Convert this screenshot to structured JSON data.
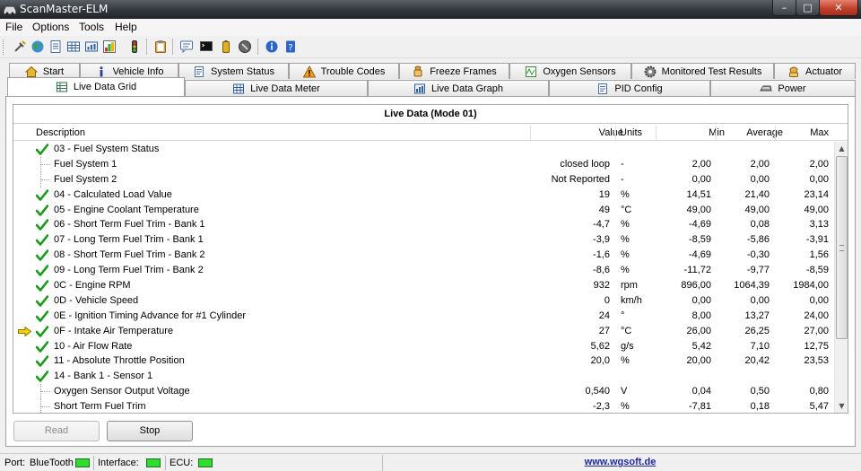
{
  "window": {
    "title": "ScanMaster-ELM",
    "controls": {
      "minimize": "–",
      "maximize": "□",
      "close": "✕"
    }
  },
  "menu": [
    "File",
    "Options",
    "Tools",
    "Help"
  ],
  "toolbar": {
    "icons": [
      "connect-icon",
      "globe-icon",
      "document-icon",
      "grid-icon",
      "table-icon",
      "chart-icon",
      "traffic-light-icon",
      "clipboard-icon",
      "terminal-chat-icon",
      "monitor-icon",
      "battery-icon",
      "stop-icon",
      "info-icon",
      "help-icon"
    ]
  },
  "tabs": {
    "row1": [
      {
        "label": "Start",
        "icon": "home-icon"
      },
      {
        "label": "Vehicle Info",
        "icon": "info-icon"
      },
      {
        "label": "System Status",
        "icon": "document-icon"
      },
      {
        "label": "Trouble Codes",
        "icon": "warning-icon"
      },
      {
        "label": "Freeze Frames",
        "icon": "snowflake-icon"
      },
      {
        "label": "Oxygen Sensors",
        "icon": "sensor-icon"
      },
      {
        "label": "Monitored Test Results",
        "icon": "gear-icon"
      },
      {
        "label": "Actuator",
        "icon": "actuator-icon"
      }
    ],
    "row2": [
      {
        "label": "Live Data Grid",
        "icon": "grid-icon",
        "active": true
      },
      {
        "label": "Live Data Meter",
        "icon": "meter-icon"
      },
      {
        "label": "Live Data Graph",
        "icon": "graph-icon"
      },
      {
        "label": "PID Config",
        "icon": "config-icon"
      },
      {
        "label": "Power",
        "icon": "power-icon"
      }
    ]
  },
  "grid": {
    "title": "Live Data (Mode 01)",
    "columns": {
      "description": "Description",
      "value": "Value",
      "units": "Units",
      "min": "Min",
      "average": "Average",
      "max": "Max"
    },
    "rows": [
      {
        "desc": "03 - Fuel System Status",
        "value": "",
        "units": "",
        "min": "",
        "avg": "",
        "max": "",
        "check": true,
        "child": false,
        "arrow": false
      },
      {
        "desc": "Fuel System 1",
        "value": "closed loop",
        "units": "-",
        "min": "2,00",
        "avg": "2,00",
        "max": "2,00",
        "check": false,
        "child": true,
        "arrow": false
      },
      {
        "desc": "Fuel System 2",
        "value": "Not Reported",
        "units": "-",
        "min": "0,00",
        "avg": "0,00",
        "max": "0,00",
        "check": false,
        "child": true,
        "arrow": false
      },
      {
        "desc": "04 - Calculated Load Value",
        "value": "19",
        "units": "%",
        "min": "14,51",
        "avg": "21,40",
        "max": "23,14",
        "check": true,
        "child": false,
        "arrow": false
      },
      {
        "desc": "05 - Engine Coolant Temperature",
        "value": "49",
        "units": "°C",
        "min": "49,00",
        "avg": "49,00",
        "max": "49,00",
        "check": true,
        "child": false,
        "arrow": false
      },
      {
        "desc": "06 - Short Term Fuel Trim - Bank 1",
        "value": "-4,7",
        "units": "%",
        "min": "-4,69",
        "avg": "0,08",
        "max": "3,13",
        "check": true,
        "child": false,
        "arrow": false
      },
      {
        "desc": "07 - Long Term Fuel Trim - Bank 1",
        "value": "-3,9",
        "units": "%",
        "min": "-8,59",
        "avg": "-5,86",
        "max": "-3,91",
        "check": true,
        "child": false,
        "arrow": false
      },
      {
        "desc": "08 - Short Term Fuel Trim - Bank 2",
        "value": "-1,6",
        "units": "%",
        "min": "-4,69",
        "avg": "-0,30",
        "max": "1,56",
        "check": true,
        "child": false,
        "arrow": false
      },
      {
        "desc": "09 - Long Term Fuel Trim - Bank 2",
        "value": "-8,6",
        "units": "%",
        "min": "-11,72",
        "avg": "-9,77",
        "max": "-8,59",
        "check": true,
        "child": false,
        "arrow": false
      },
      {
        "desc": "0C - Engine RPM",
        "value": "932",
        "units": "rpm",
        "min": "896,00",
        "avg": "1064,39",
        "max": "1984,00",
        "check": true,
        "child": false,
        "arrow": false
      },
      {
        "desc": "0D - Vehicle Speed",
        "value": "0",
        "units": "km/h",
        "min": "0,00",
        "avg": "0,00",
        "max": "0,00",
        "check": true,
        "child": false,
        "arrow": false
      },
      {
        "desc": "0E - Ignition Timing Advance for #1 Cylinder",
        "value": "24",
        "units": "°",
        "min": "8,00",
        "avg": "13,27",
        "max": "24,00",
        "check": true,
        "child": false,
        "arrow": false
      },
      {
        "desc": "0F - Intake Air Temperature",
        "value": "27",
        "units": "°C",
        "min": "26,00",
        "avg": "26,25",
        "max": "27,00",
        "check": true,
        "child": false,
        "arrow": true
      },
      {
        "desc": "10 - Air Flow Rate",
        "value": "5,62",
        "units": "g/s",
        "min": "5,42",
        "avg": "7,10",
        "max": "12,75",
        "check": true,
        "child": false,
        "arrow": false
      },
      {
        "desc": "11 - Absolute Throttle Position",
        "value": "20,0",
        "units": "%",
        "min": "20,00",
        "avg": "20,42",
        "max": "23,53",
        "check": true,
        "child": false,
        "arrow": false
      },
      {
        "desc": "14 - Bank 1 - Sensor 1",
        "value": "",
        "units": "",
        "min": "",
        "avg": "",
        "max": "",
        "check": true,
        "child": false,
        "arrow": false
      },
      {
        "desc": "Oxygen Sensor Output Voltage",
        "value": "0,540",
        "units": "V",
        "min": "0,04",
        "avg": "0,50",
        "max": "0,80",
        "check": false,
        "child": true,
        "arrow": false
      },
      {
        "desc": "Short Term Fuel Trim",
        "value": "-2,3",
        "units": "%",
        "min": "-7,81",
        "avg": "0,18",
        "max": "5,47",
        "check": false,
        "child": true,
        "arrow": false
      }
    ]
  },
  "buttons": {
    "read": "Read",
    "stop": "Stop"
  },
  "status": {
    "port_label": "Port:",
    "port_value": "BlueTooth",
    "interface_label": "Interface:",
    "ecu_label": "ECU:",
    "website": "www.wgsoft.de",
    "led_color": "#2fdc2f"
  }
}
